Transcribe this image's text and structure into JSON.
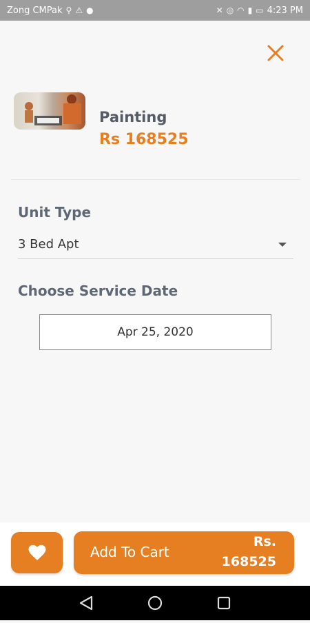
{
  "status_bar": {
    "carrier": "Zong CMPak",
    "time": "4:23 PM"
  },
  "product": {
    "name": "Painting",
    "price": "Rs 168525"
  },
  "unit_type": {
    "label": "Unit Type",
    "selected": "3 Bed Apt"
  },
  "service_date": {
    "label": "Choose Service Date",
    "value": "Apr 25, 2020"
  },
  "cart": {
    "button_label": "Add To Cart",
    "price_currency": "Rs.",
    "price_amount": "168525"
  },
  "colors": {
    "accent": "#e67e22",
    "label_text": "#5f6774",
    "status_bar": "#9e9e9e"
  },
  "icons": {
    "close": "close-icon",
    "favorite": "heart-icon",
    "dropdown": "chevron-down-icon",
    "nav_back": "back-triangle-icon",
    "nav_home": "home-circle-icon",
    "nav_recents": "recents-square-icon"
  }
}
